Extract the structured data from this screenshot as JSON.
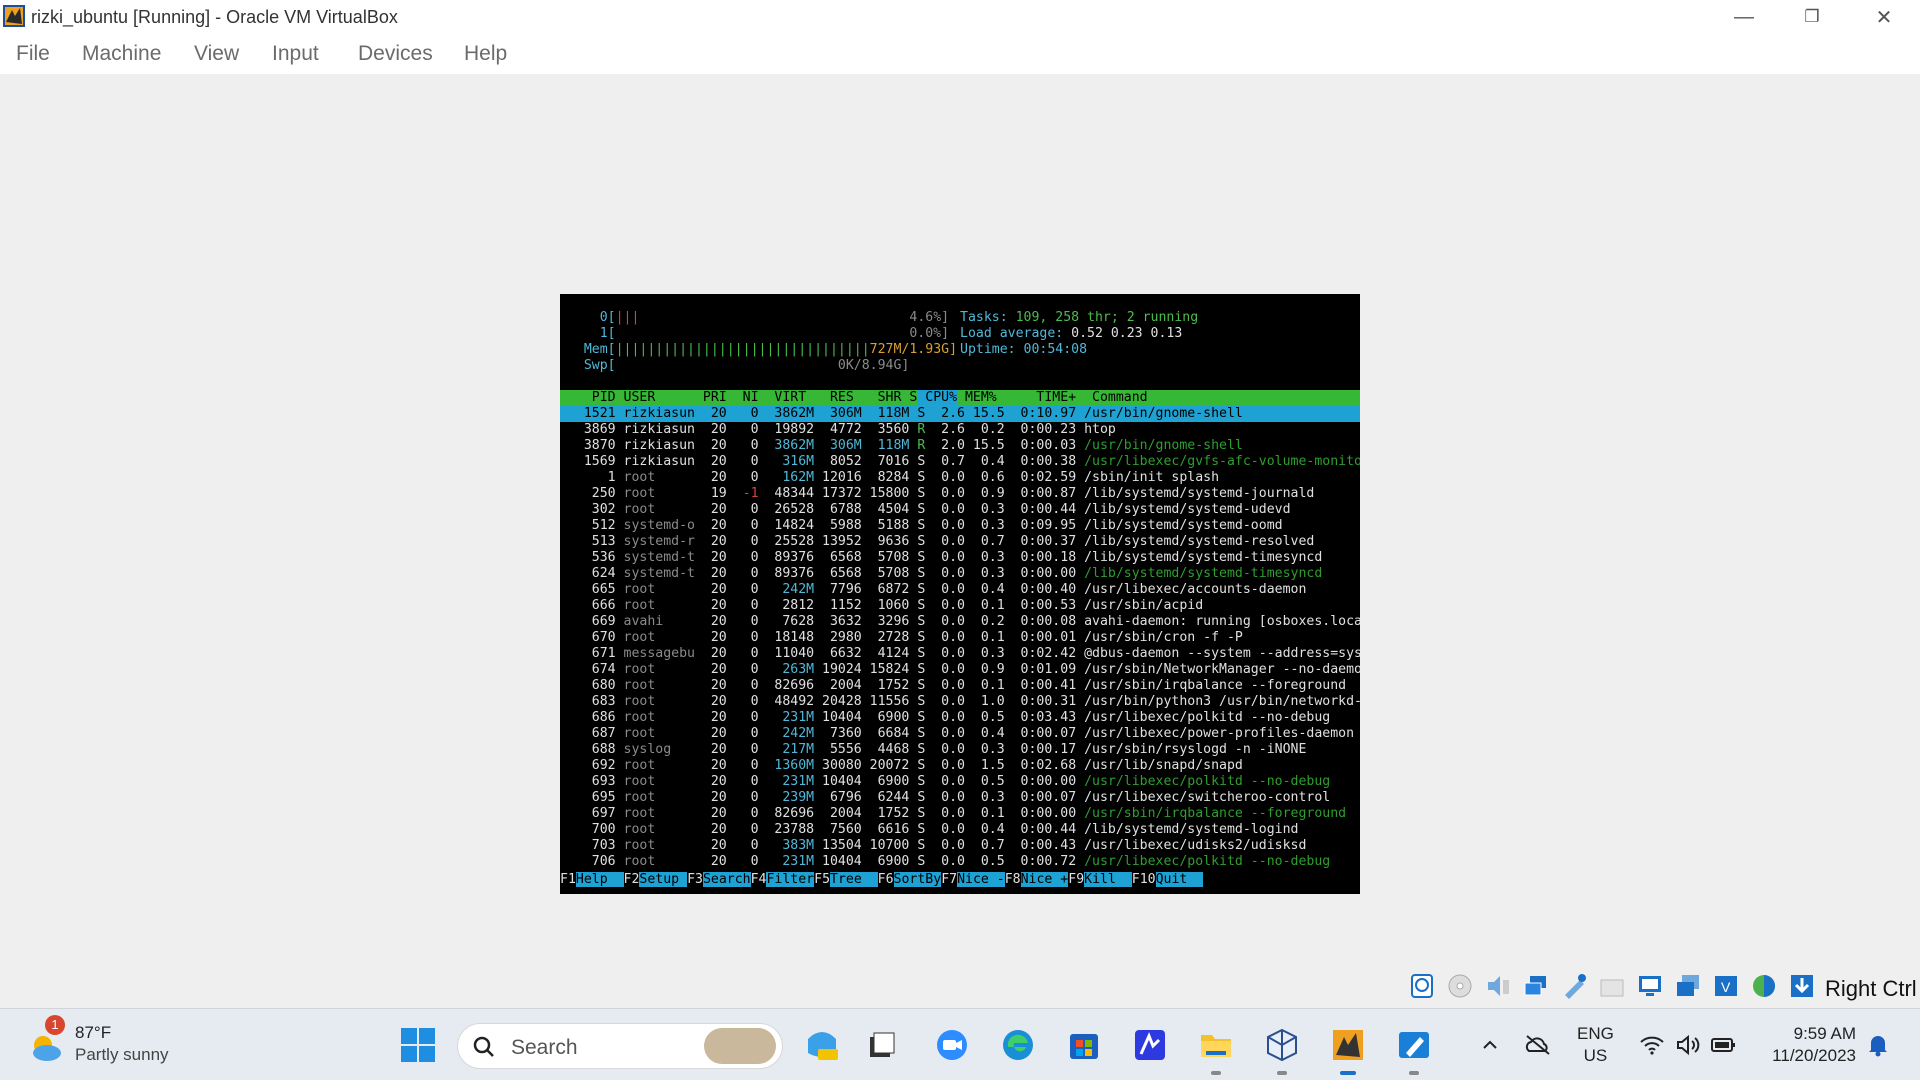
{
  "window": {
    "title": "rizki_ubuntu [Running] - Oracle VM VirtualBox",
    "minimize": "—",
    "restore": "❐",
    "close": "✕"
  },
  "menu": [
    "File",
    "Machine",
    "View",
    "Input",
    "Devices",
    "Help"
  ],
  "htop": {
    "meters": {
      "cpu0_label": "0[",
      "cpu0_bars": "|||",
      "cpu0_value": "4.6%]",
      "cpu1_label": "1[",
      "cpu1_value": "0.0%]",
      "mem_label": "Mem[",
      "mem_bars": "||||||||||||||||||||||||||||||||",
      "mem_value": "727M/1.93G]",
      "swp_label": "Swp[",
      "swp_value": "0K/8.94G]"
    },
    "summary": {
      "tasks_label": "Tasks: ",
      "tasks_value": "109, 258 thr; 2 running",
      "load_label": "Load average: ",
      "load_value": "0.52 0.23 0.13",
      "uptime_label": "Uptime: ",
      "uptime_value": "00:54:08"
    },
    "columns": [
      "PID",
      "USER",
      "PRI",
      "NI",
      "VIRT",
      "RES",
      "SHR",
      "S",
      "CPU%",
      "MEM%",
      "TIME+",
      "Command"
    ],
    "sort_column": "CPU%",
    "rows": [
      {
        "pid": "1521",
        "user": "rizkiasun",
        "pri": "20",
        "ni": "0",
        "virt": "3862M",
        "res": "306M",
        "shr": "118M",
        "s": "S",
        "cpu": "2.6",
        "mem": "15.5",
        "time": "0:10.97",
        "cmd": "/usr/bin/gnome-shell",
        "selected": true
      },
      {
        "pid": "3869",
        "user": "rizkiasun",
        "pri": "20",
        "ni": "0",
        "virt": "19892",
        "res": "4772",
        "shr": "3560",
        "s": "R",
        "cpu": "2.6",
        "mem": "0.2",
        "time": "0:00.23",
        "cmd": "htop"
      },
      {
        "pid": "3870",
        "user": "rizkiasun",
        "pri": "20",
        "ni": "0",
        "virt": "3862M",
        "res": "306M",
        "shr": "118M",
        "s": "R",
        "cpu": "2.0",
        "mem": "15.5",
        "time": "0:00.03",
        "cmd": "/usr/bin/gnome-shell",
        "thread": true
      },
      {
        "pid": "1569",
        "user": "rizkiasun",
        "pri": "20",
        "ni": "0",
        "virt": "316M",
        "res": "8052",
        "shr": "7016",
        "s": "S",
        "cpu": "0.7",
        "mem": "0.4",
        "time": "0:00.38",
        "cmd": "/usr/libexec/gvfs-afc-volume-monito",
        "thread": true
      },
      {
        "pid": "1",
        "user": "root",
        "pri": "20",
        "ni": "0",
        "virt": "162M",
        "res": "12016",
        "shr": "8284",
        "s": "S",
        "cpu": "0.0",
        "mem": "0.6",
        "time": "0:02.59",
        "cmd": "/sbin/init splash"
      },
      {
        "pid": "250",
        "user": "root",
        "pri": "19",
        "ni": "-1",
        "virt": "48344",
        "res": "17372",
        "shr": "15800",
        "s": "S",
        "cpu": "0.0",
        "mem": "0.9",
        "time": "0:00.87",
        "cmd": "/lib/systemd/systemd-journald"
      },
      {
        "pid": "302",
        "user": "root",
        "pri": "20",
        "ni": "0",
        "virt": "26528",
        "res": "6788",
        "shr": "4504",
        "s": "S",
        "cpu": "0.0",
        "mem": "0.3",
        "time": "0:00.44",
        "cmd": "/lib/systemd/systemd-udevd"
      },
      {
        "pid": "512",
        "user": "systemd-o",
        "pri": "20",
        "ni": "0",
        "virt": "14824",
        "res": "5988",
        "shr": "5188",
        "s": "S",
        "cpu": "0.0",
        "mem": "0.3",
        "time": "0:09.95",
        "cmd": "/lib/systemd/systemd-oomd"
      },
      {
        "pid": "513",
        "user": "systemd-r",
        "pri": "20",
        "ni": "0",
        "virt": "25528",
        "res": "13952",
        "shr": "9636",
        "s": "S",
        "cpu": "0.0",
        "mem": "0.7",
        "time": "0:00.37",
        "cmd": "/lib/systemd/systemd-resolved"
      },
      {
        "pid": "536",
        "user": "systemd-t",
        "pri": "20",
        "ni": "0",
        "virt": "89376",
        "res": "6568",
        "shr": "5708",
        "s": "S",
        "cpu": "0.0",
        "mem": "0.3",
        "time": "0:00.18",
        "cmd": "/lib/systemd/systemd-timesyncd"
      },
      {
        "pid": "624",
        "user": "systemd-t",
        "pri": "20",
        "ni": "0",
        "virt": "89376",
        "res": "6568",
        "shr": "5708",
        "s": "S",
        "cpu": "0.0",
        "mem": "0.3",
        "time": "0:00.00",
        "cmd": "/lib/systemd/systemd-timesyncd",
        "thread": true
      },
      {
        "pid": "665",
        "user": "root",
        "pri": "20",
        "ni": "0",
        "virt": "242M",
        "res": "7796",
        "shr": "6872",
        "s": "S",
        "cpu": "0.0",
        "mem": "0.4",
        "time": "0:00.40",
        "cmd": "/usr/libexec/accounts-daemon"
      },
      {
        "pid": "666",
        "user": "root",
        "pri": "20",
        "ni": "0",
        "virt": "2812",
        "res": "1152",
        "shr": "1060",
        "s": "S",
        "cpu": "0.0",
        "mem": "0.1",
        "time": "0:00.53",
        "cmd": "/usr/sbin/acpid"
      },
      {
        "pid": "669",
        "user": "avahi",
        "pri": "20",
        "ni": "0",
        "virt": "7628",
        "res": "3632",
        "shr": "3296",
        "s": "S",
        "cpu": "0.0",
        "mem": "0.2",
        "time": "0:00.08",
        "cmd": "avahi-daemon: running [osboxes.loca"
      },
      {
        "pid": "670",
        "user": "root",
        "pri": "20",
        "ni": "0",
        "virt": "18148",
        "res": "2980",
        "shr": "2728",
        "s": "S",
        "cpu": "0.0",
        "mem": "0.1",
        "time": "0:00.01",
        "cmd": "/usr/sbin/cron -f -P"
      },
      {
        "pid": "671",
        "user": "messagebu",
        "pri": "20",
        "ni": "0",
        "virt": "11040",
        "res": "6632",
        "shr": "4124",
        "s": "S",
        "cpu": "0.0",
        "mem": "0.3",
        "time": "0:02.42",
        "cmd": "@dbus-daemon --system --address=sys"
      },
      {
        "pid": "674",
        "user": "root",
        "pri": "20",
        "ni": "0",
        "virt": "263M",
        "res": "19024",
        "shr": "15824",
        "s": "S",
        "cpu": "0.0",
        "mem": "0.9",
        "time": "0:01.09",
        "cmd": "/usr/sbin/NetworkManager --no-daemo"
      },
      {
        "pid": "680",
        "user": "root",
        "pri": "20",
        "ni": "0",
        "virt": "82696",
        "res": "2004",
        "shr": "1752",
        "s": "S",
        "cpu": "0.0",
        "mem": "0.1",
        "time": "0:00.41",
        "cmd": "/usr/sbin/irqbalance --foreground"
      },
      {
        "pid": "683",
        "user": "root",
        "pri": "20",
        "ni": "0",
        "virt": "48492",
        "res": "20428",
        "shr": "11556",
        "s": "S",
        "cpu": "0.0",
        "mem": "1.0",
        "time": "0:00.31",
        "cmd": "/usr/bin/python3 /usr/bin/networkd-"
      },
      {
        "pid": "686",
        "user": "root",
        "pri": "20",
        "ni": "0",
        "virt": "231M",
        "res": "10404",
        "shr": "6900",
        "s": "S",
        "cpu": "0.0",
        "mem": "0.5",
        "time": "0:03.43",
        "cmd": "/usr/libexec/polkitd --no-debug"
      },
      {
        "pid": "687",
        "user": "root",
        "pri": "20",
        "ni": "0",
        "virt": "242M",
        "res": "7360",
        "shr": "6684",
        "s": "S",
        "cpu": "0.0",
        "mem": "0.4",
        "time": "0:00.07",
        "cmd": "/usr/libexec/power-profiles-daemon"
      },
      {
        "pid": "688",
        "user": "syslog",
        "pri": "20",
        "ni": "0",
        "virt": "217M",
        "res": "5556",
        "shr": "4468",
        "s": "S",
        "cpu": "0.0",
        "mem": "0.3",
        "time": "0:00.17",
        "cmd": "/usr/sbin/rsyslogd -n -iNONE"
      },
      {
        "pid": "692",
        "user": "root",
        "pri": "20",
        "ni": "0",
        "virt": "1360M",
        "res": "30080",
        "shr": "20072",
        "s": "S",
        "cpu": "0.0",
        "mem": "1.5",
        "time": "0:02.68",
        "cmd": "/usr/lib/snapd/snapd"
      },
      {
        "pid": "693",
        "user": "root",
        "pri": "20",
        "ni": "0",
        "virt": "231M",
        "res": "10404",
        "shr": "6900",
        "s": "S",
        "cpu": "0.0",
        "mem": "0.5",
        "time": "0:00.00",
        "cmd": "/usr/libexec/polkitd --no-debug",
        "thread": true
      },
      {
        "pid": "695",
        "user": "root",
        "pri": "20",
        "ni": "0",
        "virt": "239M",
        "res": "6796",
        "shr": "6244",
        "s": "S",
        "cpu": "0.0",
        "mem": "0.3",
        "time": "0:00.07",
        "cmd": "/usr/libexec/switcheroo-control"
      },
      {
        "pid": "697",
        "user": "root",
        "pri": "20",
        "ni": "0",
        "virt": "82696",
        "res": "2004",
        "shr": "1752",
        "s": "S",
        "cpu": "0.0",
        "mem": "0.1",
        "time": "0:00.00",
        "cmd": "/usr/sbin/irqbalance --foreground",
        "thread": true
      },
      {
        "pid": "700",
        "user": "root",
        "pri": "20",
        "ni": "0",
        "virt": "23788",
        "res": "7560",
        "shr": "6616",
        "s": "S",
        "cpu": "0.0",
        "mem": "0.4",
        "time": "0:00.44",
        "cmd": "/lib/systemd/systemd-logind"
      },
      {
        "pid": "703",
        "user": "root",
        "pri": "20",
        "ni": "0",
        "virt": "383M",
        "res": "13504",
        "shr": "10700",
        "s": "S",
        "cpu": "0.0",
        "mem": "0.7",
        "time": "0:00.43",
        "cmd": "/usr/libexec/udisks2/udisksd"
      },
      {
        "pid": "706",
        "user": "root",
        "pri": "20",
        "ni": "0",
        "virt": "231M",
        "res": "10404",
        "shr": "6900",
        "s": "S",
        "cpu": "0.0",
        "mem": "0.5",
        "time": "0:00.72",
        "cmd": "/usr/libexec/polkitd --no-debug",
        "thread": true
      }
    ],
    "fkeys": [
      {
        "key": "F1",
        "label": "Help  "
      },
      {
        "key": "F2",
        "label": "Setup "
      },
      {
        "key": "F3",
        "label": "Search"
      },
      {
        "key": "F4",
        "label": "Filter"
      },
      {
        "key": "F5",
        "label": "Tree  "
      },
      {
        "key": "F6",
        "label": "SortBy"
      },
      {
        "key": "F7",
        "label": "Nice -"
      },
      {
        "key": "F8",
        "label": "Nice +"
      },
      {
        "key": "F9",
        "label": "Kill  "
      },
      {
        "key": "F10",
        "label": "Quit  "
      }
    ]
  },
  "statusbar": {
    "icons": [
      "hard-disk-icon",
      "optical-drive-icon",
      "audio-icon",
      "network-icon",
      "usb-icon",
      "shared-folders-icon",
      "display-icon",
      "snapshot-icon",
      "recording-icon",
      "mouse-integration-icon",
      "download-icon"
    ],
    "host_key": "Right Ctrl"
  },
  "taskbar": {
    "weather_temp": "87°F",
    "weather_desc": "Partly sunny",
    "weather_badge": "1",
    "search_placeholder": "Search",
    "lang_top": "ENG",
    "lang_bottom": "US",
    "time": "9:59 AM",
    "date": "11/20/2023"
  },
  "colors": {
    "header_green": "#36b836",
    "select_cyan": "#1ea2d4",
    "terminal_bg": "#000000",
    "taskbar_bg": "#e6ebf2"
  }
}
